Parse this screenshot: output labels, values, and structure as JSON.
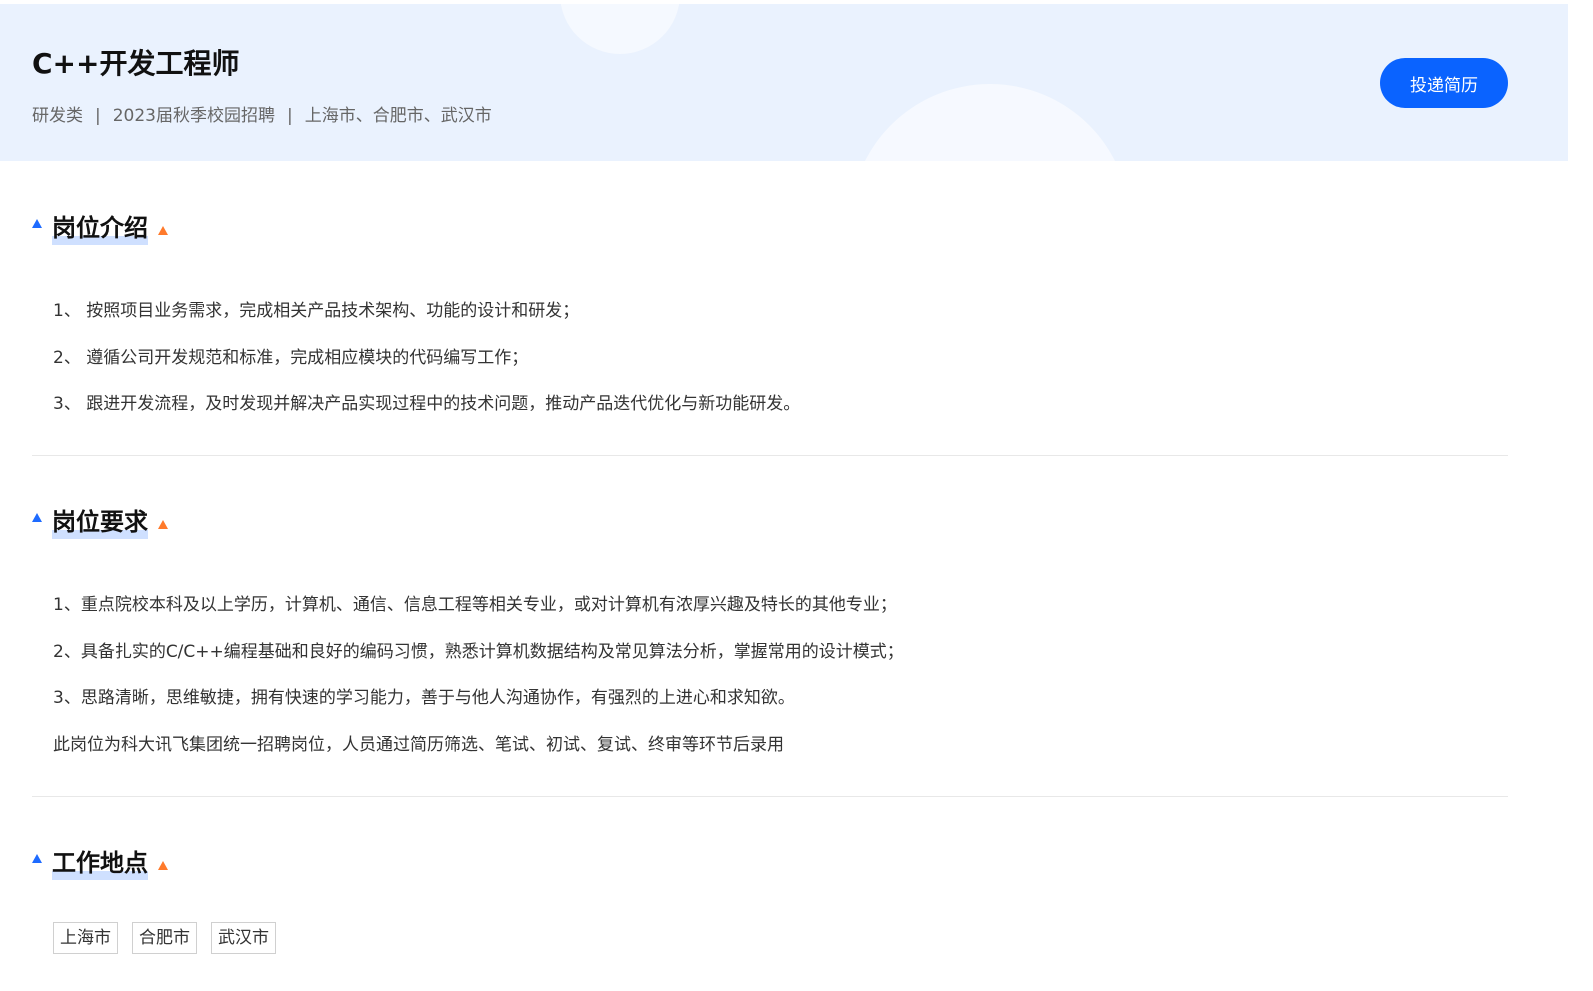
{
  "header": {
    "title": "C++开发工程师",
    "meta": {
      "category": "研发类",
      "separator": "|",
      "recruitment": "2023届秋季校园招聘",
      "locations": "上海市、合肥市、武汉市"
    },
    "apply_button": "投递简历"
  },
  "colors": {
    "accent": "#0a63ff",
    "header_bg": "#eaf2fe",
    "title_triangle_left": "#1e6bff",
    "title_triangle_right": "#ff7a2b"
  },
  "sections": {
    "intro": {
      "title": "岗位介绍",
      "items": [
        "1、 按照项目业务需求，完成相关产品技术架构、功能的设计和研发；",
        "2、 遵循公司开发规范和标准，完成相应模块的代码编写工作；",
        "3、 跟进开发流程，及时发现并解决产品实现过程中的技术问题，推动产品迭代优化与新功能研发。"
      ]
    },
    "requirements": {
      "title": "岗位要求",
      "items": [
        "1、重点院校本科及以上学历，计算机、通信、信息工程等相关专业，或对计算机有浓厚兴趣及特长的其他专业；",
        "2、具备扎实的C/C++编程基础和良好的编码习惯，熟悉计算机数据结构及常见算法分析，掌握常用的设计模式；",
        "3、思路清晰，思维敏捷，拥有快速的学习能力，善于与他人沟通协作，有强烈的上进心和求知欲。",
        "此岗位为科大讯飞集团统一招聘岗位，人员通过简历筛选、笔试、初试、复试、终审等环节后录用"
      ]
    },
    "location": {
      "title": "工作地点",
      "tags": [
        "上海市",
        "合肥市",
        "武汉市"
      ]
    }
  }
}
